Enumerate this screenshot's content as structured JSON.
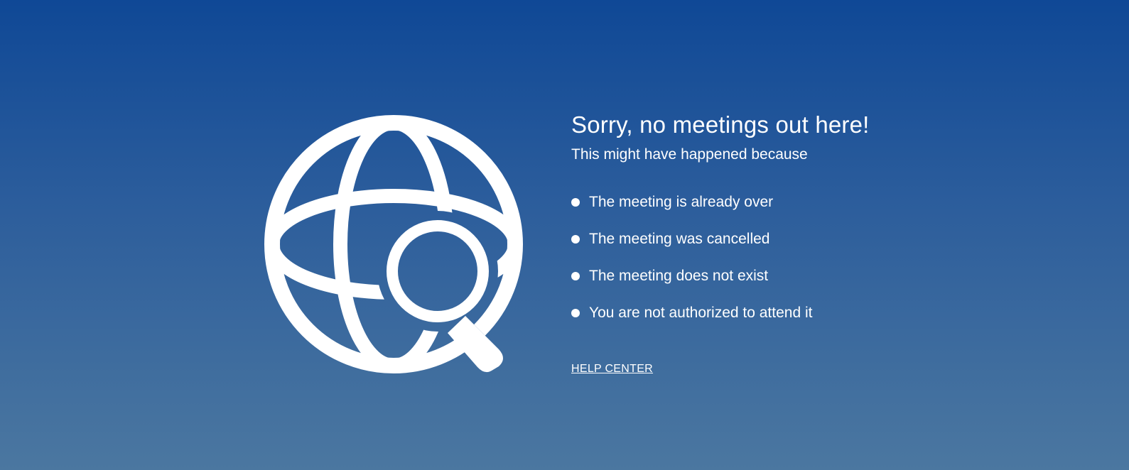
{
  "error": {
    "title": "Sorry, no meetings out here!",
    "subtitle": "This might have happened because",
    "reasons": [
      "The meeting is already over",
      "The meeting was cancelled",
      "The meeting does not exist",
      "You are not authorized to attend it"
    ],
    "help_link": "HELP CENTER",
    "icon": "globe-search-icon"
  },
  "colors": {
    "background_top": "#0f4896",
    "background_bottom": "#4b77a0",
    "foreground": "#ffffff"
  }
}
